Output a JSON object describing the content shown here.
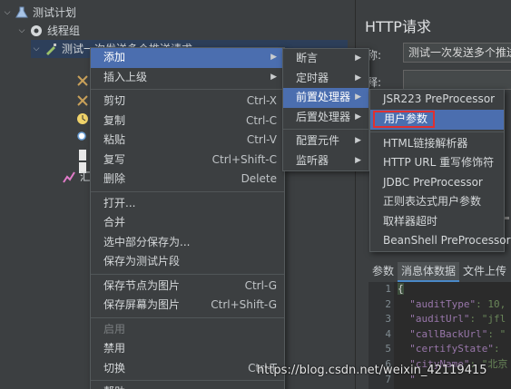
{
  "tree": {
    "test_plan": "测试计划",
    "thread_group": "线程组",
    "sampler": "测试一次发送多个推送请求",
    "other_node": "汇"
  },
  "right_panel": {
    "title": "HTTP请求",
    "name_label": "称:",
    "name_value": "测试一次发送多个推送",
    "comment_label": "释:",
    "tabs": [
      "参数",
      "消息体数据",
      "文件上传"
    ],
    "active_tab": 1,
    "line_numbers": [
      "1",
      "2",
      "3",
      "4",
      "5",
      "6",
      "7"
    ],
    "code_lines": [
      {
        "key": "{",
        "val": ""
      },
      {
        "key": "\"auditType\"",
        "val": ": 10,"
      },
      {
        "key": "\"auditUrl\"",
        "val": ": \"jfl"
      },
      {
        "key": "\"callBackUrl\"",
        "val": ": \""
      },
      {
        "key": "\"certifyState\"",
        "val": ":"
      },
      {
        "key": "\"cityName\"",
        "val": ": \"北京"
      },
      {
        "key": "\"",
        "val": ""
      }
    ]
  },
  "menu1": {
    "items": [
      {
        "label": "添加",
        "shortcut": "",
        "submenu": true,
        "highlight": true,
        "disabled": false
      },
      {
        "label": "插入上级",
        "shortcut": "",
        "submenu": true,
        "highlight": false,
        "disabled": false
      },
      {
        "sep": true
      },
      {
        "label": "剪切",
        "shortcut": "Ctrl-X",
        "submenu": false,
        "highlight": false,
        "disabled": false
      },
      {
        "label": "复制",
        "shortcut": "Ctrl-C",
        "submenu": false,
        "highlight": false,
        "disabled": false
      },
      {
        "label": "粘贴",
        "shortcut": "Ctrl-V",
        "submenu": false,
        "highlight": false,
        "disabled": false
      },
      {
        "label": "复写",
        "shortcut": "Ctrl+Shift-C",
        "submenu": false,
        "highlight": false,
        "disabled": false
      },
      {
        "label": "删除",
        "shortcut": "Delete",
        "submenu": false,
        "highlight": false,
        "disabled": false
      },
      {
        "sep": true
      },
      {
        "label": "打开...",
        "shortcut": "",
        "submenu": false,
        "highlight": false,
        "disabled": false
      },
      {
        "label": "合并",
        "shortcut": "",
        "submenu": false,
        "highlight": false,
        "disabled": false
      },
      {
        "label": "选中部分保存为...",
        "shortcut": "",
        "submenu": false,
        "highlight": false,
        "disabled": false
      },
      {
        "label": "保存为测试片段",
        "shortcut": "",
        "submenu": false,
        "highlight": false,
        "disabled": false
      },
      {
        "sep": true
      },
      {
        "label": "保存节点为图片",
        "shortcut": "Ctrl-G",
        "submenu": false,
        "highlight": false,
        "disabled": false
      },
      {
        "label": "保存屏幕为图片",
        "shortcut": "Ctrl+Shift-G",
        "submenu": false,
        "highlight": false,
        "disabled": false
      },
      {
        "sep": true
      },
      {
        "label": "启用",
        "shortcut": "",
        "submenu": false,
        "highlight": false,
        "disabled": true
      },
      {
        "label": "禁用",
        "shortcut": "",
        "submenu": false,
        "highlight": false,
        "disabled": false
      },
      {
        "label": "切换",
        "shortcut": "Ctrl-T",
        "submenu": false,
        "highlight": false,
        "disabled": false
      },
      {
        "sep": true
      },
      {
        "label": "帮助",
        "shortcut": "",
        "submenu": false,
        "highlight": false,
        "disabled": false
      }
    ]
  },
  "menu2": {
    "items": [
      {
        "label": "断言",
        "submenu": true,
        "highlight": false
      },
      {
        "label": "定时器",
        "submenu": true,
        "highlight": false
      },
      {
        "label": "前置处理器",
        "submenu": true,
        "highlight": true
      },
      {
        "label": "后置处理器",
        "submenu": true,
        "highlight": false
      },
      {
        "sep": true
      },
      {
        "label": "配置元件",
        "submenu": true,
        "highlight": false
      },
      {
        "label": "监听器",
        "submenu": true,
        "highlight": false
      }
    ]
  },
  "menu3": {
    "items": [
      {
        "label": "JSR223 PreProcessor",
        "highlight": false,
        "boxed": false
      },
      {
        "label": "用户参数",
        "highlight": true,
        "boxed": true
      },
      {
        "sep": true
      },
      {
        "label": "HTML链接解析器",
        "highlight": false,
        "boxed": false
      },
      {
        "label": "HTTP URL 重写修饰符",
        "highlight": false,
        "boxed": false
      },
      {
        "label": "JDBC PreProcessor",
        "highlight": false,
        "boxed": false
      },
      {
        "label": "正则表达式用户参数",
        "highlight": false,
        "boxed": false
      },
      {
        "label": "取样器超时",
        "highlight": false,
        "boxed": false
      },
      {
        "label": "BeanShell PreProcessor",
        "highlight": false,
        "boxed": false
      }
    ]
  },
  "watermark": "https://blog.csdn.net/weixin_42119415",
  "colors": {
    "background": "#3c3f41",
    "highlight": "#4b6eaf",
    "selection": "#2d3f5a",
    "box": "#e03030"
  },
  "icons": {
    "submenu_arrow": "chevron-right-icon",
    "expand_arrow": "chevron-down-icon"
  }
}
